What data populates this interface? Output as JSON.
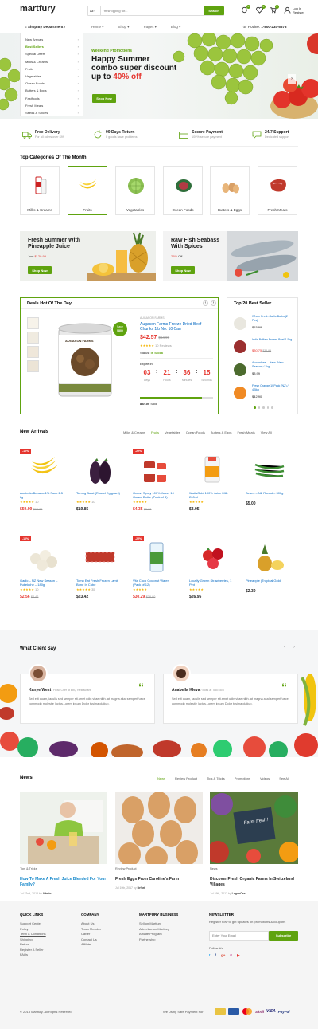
{
  "header": {
    "logo": "martfury",
    "search_category": "All",
    "search_placeholder": "I'm shopping for...",
    "search_button": "Search",
    "compare_count": "0",
    "wishlist_count": "0",
    "cart_count": "0",
    "login_line1": "Log In",
    "login_line2": "Register"
  },
  "nav": {
    "shop_by_dept": "Shop By Department",
    "items": [
      "Home",
      "Shop",
      "Pages",
      "Blog"
    ],
    "hotline_label": "Hotline:",
    "hotline": "1-800-234-5678"
  },
  "departments": [
    "New Arrivals",
    "Best Sellers",
    "Special Offers",
    "Milks & Creams",
    "Fruits",
    "Vegetables",
    "Ocean Foods",
    "Butters & Eggs",
    "Fastfoods",
    "Fresh Meats",
    "Seeds & Spices"
  ],
  "hero": {
    "kicker": "Weekend Promotions",
    "line1": "Happy Summer",
    "line2": "combo super discount",
    "line3_pre": "up to ",
    "line3_hl": "40% off",
    "button": "Shop Now"
  },
  "features": [
    {
      "title": "Free Delivery",
      "sub": "For all oders over $99",
      "icon": "truck-icon"
    },
    {
      "title": "90 Days Return",
      "sub": "If goods have problems",
      "icon": "return-icon"
    },
    {
      "title": "Secure Payment",
      "sub": "100% secure payment",
      "icon": "card-icon"
    },
    {
      "title": "24/7 Support",
      "sub": "Dedicated support",
      "icon": "chat-icon"
    }
  ],
  "top_categories": {
    "title": "Top Categories Of The Month",
    "items": [
      "Milks & Creams",
      "Fruits",
      "Vegetables",
      "Ocean Foods",
      "Butters & Eggs",
      "Fresh Meats"
    ]
  },
  "promo1": {
    "line1": "Fresh Summer With",
    "line2": "Pineapple Juice",
    "price_pre": "Just ",
    "price": "$129.99",
    "button": "Shop Now"
  },
  "promo2": {
    "line1": "Raw Fish Seabass",
    "line2": "With Spices",
    "price": "25%",
    "price_post": " Off",
    "button": "Shop Now"
  },
  "deals": {
    "title": "Deals Hot Of The Day",
    "brand": "AUGASON FARMS",
    "name": "Augason Farms Freeze Dried Beef Chunks 1lb No. 10 Can",
    "price": "$42.57",
    "old_price": "$64.99",
    "reviews": "10 Reviews",
    "status_label": "Status:",
    "status": "In Stock",
    "expires": "Expire In",
    "save_line1": "Save",
    "save_line2": "$800",
    "can_label": "AUGASON FARMS",
    "countdown": [
      {
        "v": "03",
        "l": "Days"
      },
      {
        "v": "21",
        "l": "Hours"
      },
      {
        "v": "36",
        "l": "Minutes"
      },
      {
        "v": "15",
        "l": "Seconds"
      }
    ],
    "sold": "85/100",
    "sold_label": " Sold",
    "sold_fraction": 0.85
  },
  "best_seller": {
    "title": "Top 20 Best Seller",
    "items": [
      {
        "name": "Whole Fresh Garlic Bulbs (2 Pcs)",
        "price": "$15.99",
        "old": ""
      },
      {
        "name": "India Buffalo Frozen Beef 1.5kg",
        "price": "$30.75",
        "old": "$34.99"
      },
      {
        "name": "Avocadoes – Hass (New Season) / 1kg",
        "price": "$3.99",
        "old": ""
      },
      {
        "name": "Fresh Orange 1) Pack (NZ) / 4.5kg",
        "price": "$42.90",
        "old": ""
      }
    ]
  },
  "new_arrivals": {
    "title": "New Arrivals",
    "tabs": [
      "Milks & Creams",
      "Fruits",
      "Vegetables",
      "Ocean Foods",
      "Butters & Eggs",
      "Fresh Meats",
      "View All"
    ],
    "products": [
      {
        "name": "Australia Banana 1% Pack 2.5 kg",
        "stars": "★★★★★",
        "rev": "10",
        "price": "$59.99",
        "old": "$68.86",
        "sale": "-10%"
      },
      {
        "name": "Terung Bulat (Round Eggplant)",
        "stars": "★★★★★",
        "rev": "10",
        "price": "$19.85",
        "old": "",
        "sale": ""
      },
      {
        "name": "Ocean Spray 100% Juice, 10 Ounce Bottle (Pack of 8)",
        "stars": "★★★★★",
        "rev": "",
        "price": "$4.35",
        "old": "$5.60",
        "sale": "-22%"
      },
      {
        "name": "WattsGold 100% Juice Milk 200ml",
        "stars": "★★★★★",
        "rev": "",
        "price": "$3.95",
        "old": "",
        "sale": ""
      },
      {
        "name": "Beans – NZ Round – 300g",
        "stars": "",
        "rev": "",
        "price": "$5.00",
        "old": "",
        "sale": ""
      },
      {
        "name": "Garlic – NZ New Season – Pukekohe – 180g",
        "stars": "★★★★★",
        "rev": "10",
        "price": "$2.56",
        "old": "$4.42",
        "sale": "-10%"
      },
      {
        "name": "Tomo Eat Fresh Frozen Lamb Bone In Cube",
        "stars": "★★★★★",
        "rev": "35",
        "price": "$23.42",
        "old": "",
        "sale": ""
      },
      {
        "name": "Vita Coco Coconut Water (Pack of 12)",
        "stars": "★★★★★",
        "rev": "",
        "price": "$30.29",
        "old": "$38.80",
        "sale": "-22%"
      },
      {
        "name": "Locally Grown Strawberries, 1 Pint",
        "stars": "★★★★★",
        "rev": "",
        "price": "$26.95",
        "old": "",
        "sale": ""
      },
      {
        "name": "Pineapple (Tropical Gold)",
        "stars": "",
        "rev": "",
        "price": "$2.30",
        "old": "",
        "sale": ""
      }
    ]
  },
  "testimonials": {
    "title": "What Client Say",
    "items": [
      {
        "name": "Kanye West",
        "role": " / Head Chef at BBQ Restaurant",
        "text": "Sed elit quam, iaculis sed semper sit amet udin vitae nibh. at magna akal semperFusce commodo molestie luctus.Lorem ipsum Dolor tusima olatiup."
      },
      {
        "name": "Anabella Kleva",
        "role": " / Boss at TocoToco",
        "text": "Sed elit quam, iaculis sed semper sit amet udin vitae nibh. at magna akal semperFusce commodo molestie luctus.Lorem ipsum Dolor tusima olatiup."
      }
    ]
  },
  "news": {
    "title": "News",
    "tabs": [
      "News",
      "Review Product",
      "Tips & Tricks",
      "Promotions",
      "Videos",
      "See All"
    ],
    "items": [
      {
        "cat": "Tips & Tricks",
        "title": "How To Make A Fresh Juice Blended For Your Family?",
        "date": "Jul 22nd, 2018",
        "by": " by ",
        "author": "Admin"
      },
      {
        "cat": "Review Product",
        "title": "Fresh Eggs From Caroline's Farm",
        "date": "Jul 19th, 2017",
        "by": " by ",
        "author": "Drfuri"
      },
      {
        "cat": "News",
        "title": "Discover Fresh Organic Farms In Switzeland Villages",
        "date": "Jul 19th, 2017",
        "by": " by ",
        "author": "LoganCee"
      }
    ],
    "sign_text": "Farm fresh!"
  },
  "footer": {
    "cols": [
      {
        "title": "QUICK LINKS",
        "links": [
          "Support Center",
          "Policy",
          "Term & Conditions",
          "Shipping",
          "Return",
          "Register A Seller",
          "FAQs"
        ]
      },
      {
        "title": "COMPANY",
        "links": [
          "About Us",
          "Team Member",
          "Carrer",
          "Contact Us",
          "Affilate"
        ]
      },
      {
        "title": "MARTFURY BUSINESS",
        "links": [
          "Sell on Martfury",
          "Advertise on Martfury",
          "Affilate Program",
          "Partnership"
        ]
      }
    ],
    "newsletter_title": "NEWSLETTER",
    "newsletter_text": "Register now to get updates on promotions & coupons",
    "email_placeholder": "Enter Your Email",
    "subscribe": "Subscribe",
    "follow": "Follow Us",
    "copyright": "© 2018 Martfury. All Rights Reserved",
    "payment_label": "We Using Safe Payment For",
    "payments": [
      "",
      "",
      "",
      "Skrill",
      "VISA",
      "PayPal"
    ]
  },
  "colors": {
    "accent": "#5fa30f",
    "sale": "#e5352e"
  }
}
